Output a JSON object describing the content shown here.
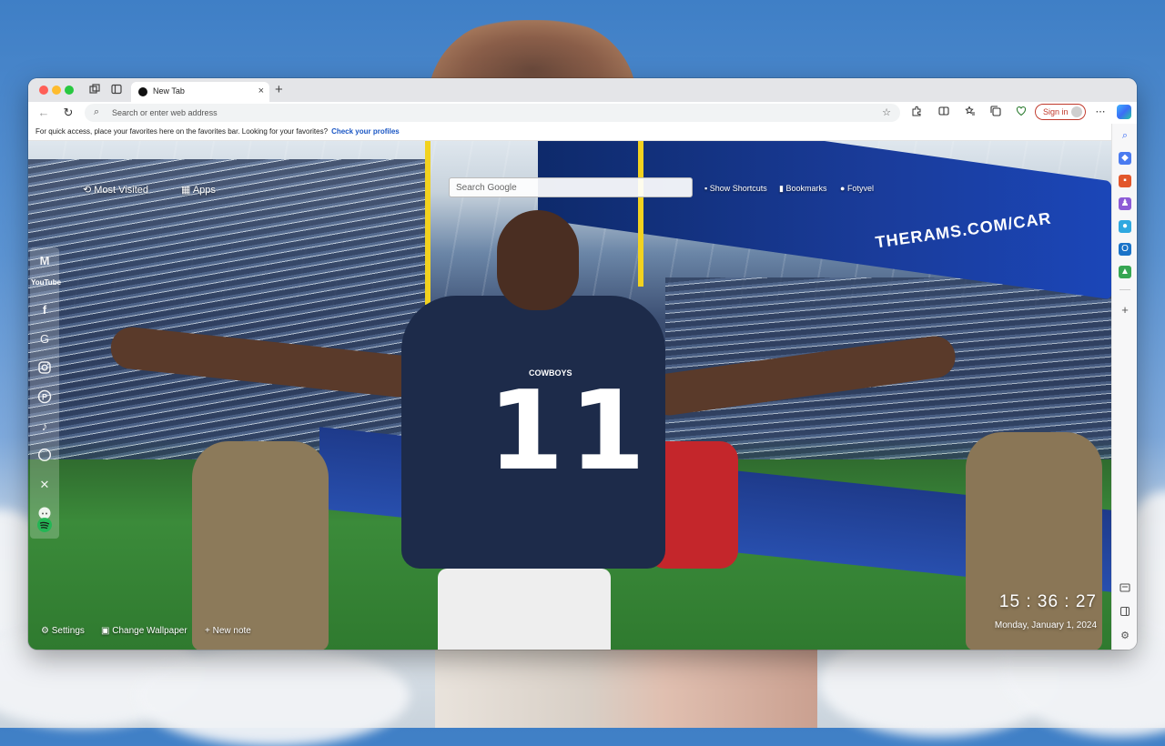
{
  "browser": {
    "tab": {
      "title": "New Tab",
      "close": "×"
    },
    "new_tab": "+",
    "omnibox": {
      "placeholder": "Search or enter web address"
    },
    "sign_in_label": "Sign in",
    "favorites_bar": {
      "message": "For quick access, place your favorites here on the favorites bar. Looking for your favorites?",
      "link": "Check your profiles"
    }
  },
  "newtab": {
    "top_links": {
      "most_visited": "Most Visited",
      "apps": "Apps"
    },
    "search": {
      "placeholder": "Search Google"
    },
    "right_links": {
      "show_shortcuts": "Show Shortcuts",
      "bookmarks": "Bookmarks",
      "profile": "Fotyvel"
    },
    "wallpaper_text": {
      "board": "THERAMS.COM/CAR",
      "jersey_number": "11",
      "jersey_team": "COWBOYS"
    },
    "dock": {
      "youtube_label": "YouTube"
    },
    "bottom": {
      "settings": "Settings",
      "change_wallpaper": "Change Wallpaper",
      "new_note": "+ New note"
    },
    "clock": {
      "time": "15 : 36 : 27",
      "date": "Monday, January 1, 2024"
    }
  },
  "icons": {
    "back": "←",
    "reload": "↻",
    "search": "⌕",
    "star": "☆",
    "more": "⋯",
    "add": "+",
    "gear": "⚙"
  }
}
